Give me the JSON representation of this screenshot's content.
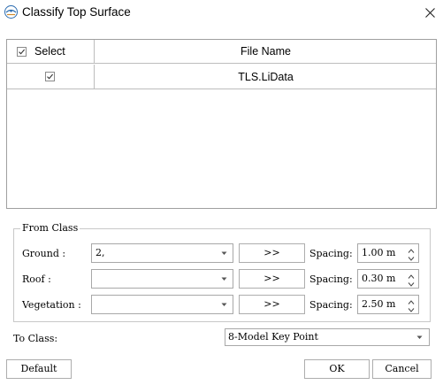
{
  "window": {
    "title": "Classify Top Surface",
    "app_icon": "lidar-app-icon",
    "close_icon": "close-icon"
  },
  "table": {
    "headers": {
      "select": "Select",
      "file_name": "File Name"
    },
    "header_checked": true,
    "rows": [
      {
        "checked": true,
        "file_name": "TLS.LiData"
      }
    ]
  },
  "from_class": {
    "group_title": "From Class",
    "rows": [
      {
        "label": "Ground :",
        "value": "2,",
        "button": ">>",
        "spacing_label": "Spacing:",
        "spacing": "1.00 m"
      },
      {
        "label": "Roof :",
        "value": "",
        "button": ">>",
        "spacing_label": "Spacing:",
        "spacing": "0.30 m"
      },
      {
        "label": "Vegetation :",
        "value": "",
        "button": ">>",
        "spacing_label": "Spacing:",
        "spacing": "2.50 m"
      }
    ]
  },
  "to_class": {
    "label": "To Class:",
    "value": "8-Model Key Point"
  },
  "buttons": {
    "default": "Default",
    "ok": "OK",
    "cancel": "Cancel"
  },
  "colors": {
    "border": "#a0a0a0",
    "check": "#333333"
  }
}
